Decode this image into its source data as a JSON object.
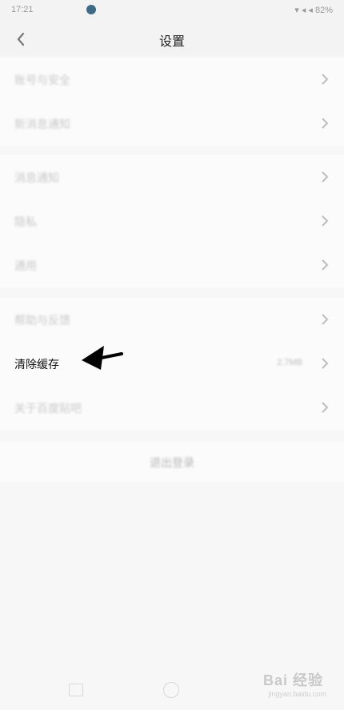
{
  "status_bar": {
    "time": "17:21",
    "right": "▾ ◂ ◂ 82%"
  },
  "header": {
    "title": "设置"
  },
  "groups": [
    {
      "items": [
        {
          "label": "账号与安全"
        },
        {
          "label": "新消息通知"
        }
      ]
    },
    {
      "items": [
        {
          "label": "消息通知"
        },
        {
          "label": "隐私"
        },
        {
          "label": "通用"
        }
      ]
    },
    {
      "items": [
        {
          "label": "帮助与反馈"
        },
        {
          "label": "清除缓存",
          "value": "2.7MB"
        },
        {
          "label": "关于百度贴吧"
        }
      ]
    }
  ],
  "logout": {
    "label": "退出登录"
  },
  "watermark": {
    "brand": "Bai 经验",
    "url": "jingyan.baidu.com"
  },
  "colors": {
    "background": "#f7f7f7",
    "row": "#fbfbfb",
    "sharp_text": "#111111"
  }
}
